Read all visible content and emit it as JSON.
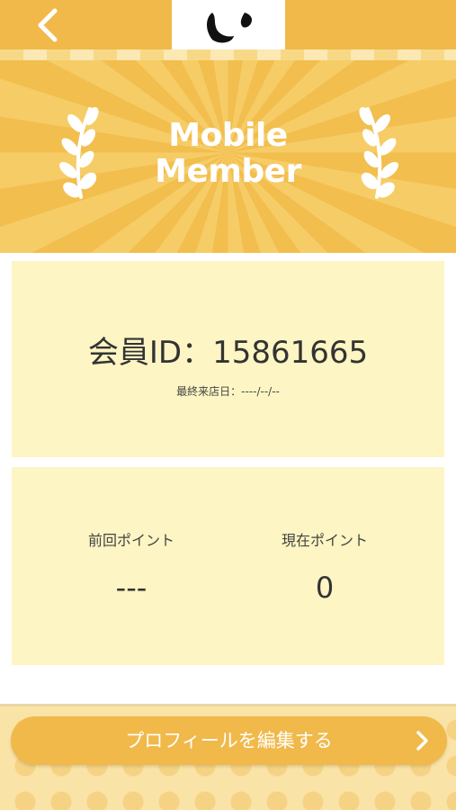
{
  "header": {
    "back_icon": "chevron-left-icon",
    "logo_icon": "brand-logo-icon"
  },
  "hero": {
    "title_line1": "Mobile",
    "title_line2": "Member",
    "decor_icon": "laurel-icon"
  },
  "member": {
    "id_text": "会員ID：15861665",
    "last_visit_text": "最終来店日：----/--/--"
  },
  "points": {
    "previous_label": "前回ポイント",
    "previous_value": "---",
    "current_label": "現在ポイント",
    "current_value": "0"
  },
  "footer": {
    "edit_profile_label": "プロフィールを編集する",
    "edit_icon": "chevron-right-icon"
  },
  "colors": {
    "accent": "#f0b94a",
    "card_bg": "#fdf5c3",
    "footer_bg": "#fae3a6"
  }
}
